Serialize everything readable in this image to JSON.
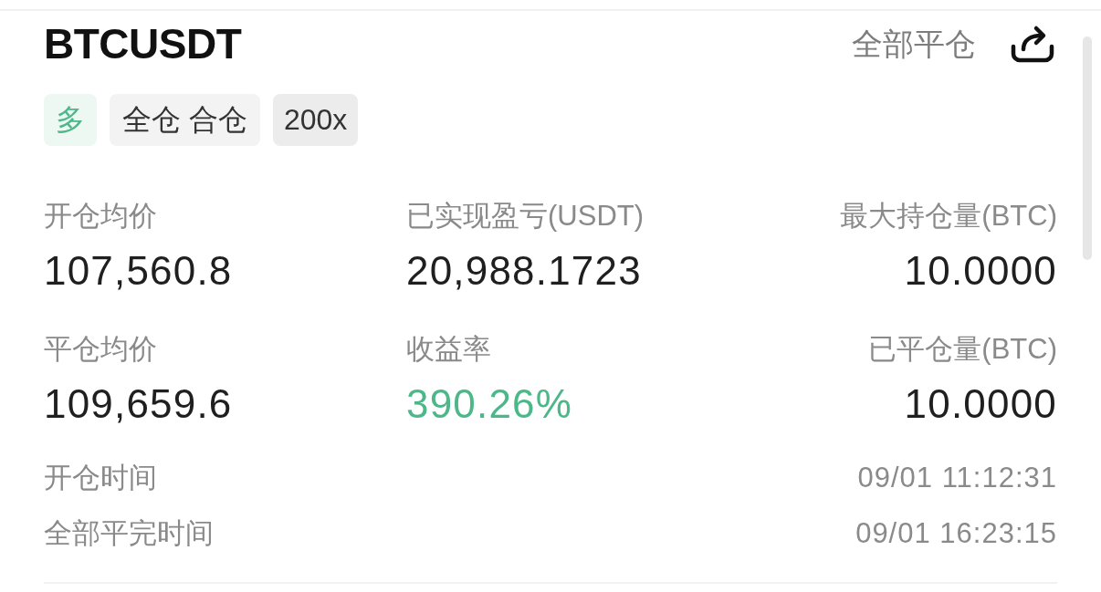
{
  "position": {
    "symbol": "BTCUSDT",
    "close_all": "全部平仓",
    "tags": [
      {
        "label": "多",
        "kind": "side"
      },
      {
        "label": "全仓 合仓",
        "kind": "mode"
      },
      {
        "label": "200x",
        "kind": "leverage"
      }
    ],
    "stats": [
      {
        "label": "开仓均价",
        "value": "107,560.8",
        "color": "#1f1f1f"
      },
      {
        "label": "已实现盈亏(USDT)",
        "value": "20,988.1723",
        "color": "#1f1f1f"
      },
      {
        "label": "最大持仓量(BTC)",
        "value": "10.0000",
        "color": "#1f1f1f"
      },
      {
        "label": "平仓均价",
        "value": "109,659.6",
        "color": "#1f1f1f"
      },
      {
        "label": "收益率",
        "value": "390.26%",
        "color": "#4cb88a"
      },
      {
        "label": "已平仓量(BTC)",
        "value": "10.0000",
        "color": "#1f1f1f"
      }
    ],
    "times": [
      {
        "label": "开仓时间",
        "value": "09/01 11:12:31"
      },
      {
        "label": "全部平完时间",
        "value": "09/01 16:23:15"
      }
    ]
  }
}
